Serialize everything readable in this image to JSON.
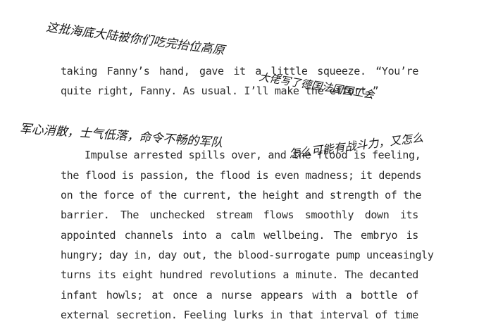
{
  "text_lines": [
    "taking Fanny’s hand, gave it a little squeeze. “You’re",
    "quite right, Fanny. As usual. I’ll make the effort.”",
    "Impulse arrested spills over, and the flood is feeling,",
    "the flood is passion, the flood is even madness; it depends",
    "on the force of the current, the height and strength of the",
    "barrier. The unchecked stream flows smoothly down its",
    "appointed channels into a calm wellbeing. The embryo is",
    "hungry; day in, day out, the blood-surrogate pump unceasingly",
    "turns its eight hundred revolutions a minute. The decanted",
    "infant howls; at once a nurse appears with a bottle of",
    "external secretion. Feeling lurks in that interval of time"
  ],
  "handwriting": [
    "这批海底大陆被你们吃完抬位高原",
    "大佬写了德国法国国工会",
    "军心消散，士气低落，命令不畅的军队",
    "怎么可能有战斗力，又怎么"
  ]
}
